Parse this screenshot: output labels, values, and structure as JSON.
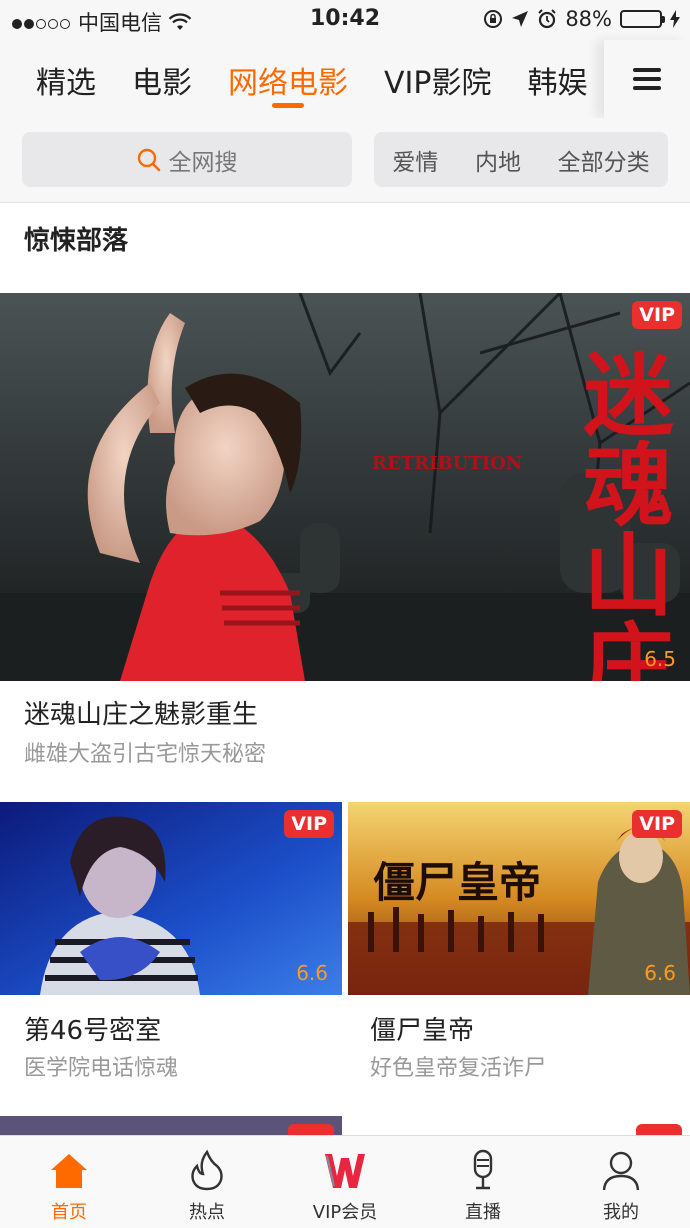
{
  "status": {
    "carrier": "中国电信",
    "time": "10:42",
    "battery": "88%"
  },
  "tabs": [
    "精选",
    "电影",
    "网络电影",
    "VIP影院",
    "韩娱"
  ],
  "search": {
    "label": "全网搜"
  },
  "categories": [
    "爱情",
    "内地",
    "全部分类"
  ],
  "section_title": "惊悚部落",
  "items": [
    {
      "title": "迷魂山庄之魅影重生",
      "subtitle": "雌雄大盗引古宅惊天秘密",
      "badge": "VIP",
      "score": "6.5",
      "poster_text": "迷魂山庄",
      "poster_en": "RETRIBUTION"
    },
    {
      "title": "第46号密室",
      "subtitle": "医学院电话惊魂",
      "badge": "VIP",
      "score": "6.6"
    },
    {
      "title": "僵尸皇帝",
      "subtitle": "好色皇帝复活诈尸",
      "badge": "VIP",
      "score": "6.6",
      "poster_text": "僵尸皇帝"
    }
  ],
  "tabbar": [
    "首页",
    "热点",
    "VIP会员",
    "直播",
    "我的"
  ],
  "colors": {
    "accent": "#ff6a00",
    "vip": "#e9302f",
    "score": "#ff9a1f"
  }
}
